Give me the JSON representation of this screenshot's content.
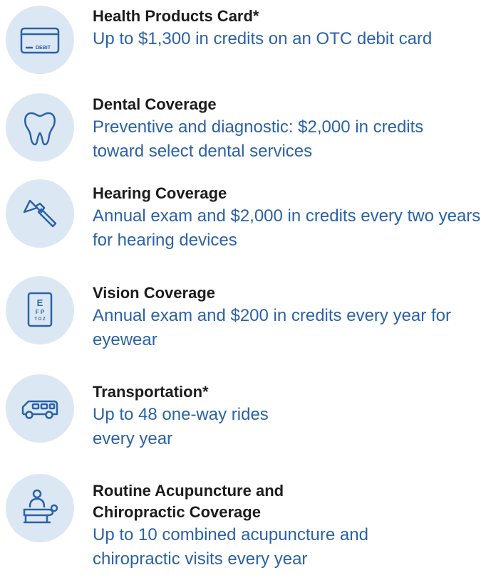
{
  "benefits": [
    {
      "icon": "debit-card-icon",
      "icon_text": "DEBIT",
      "title": "Health Products Card*",
      "description": "Up to $1,300 in credits on an OTC debit card"
    },
    {
      "icon": "tooth-icon",
      "title": "Dental Coverage",
      "description": "Preventive and diagnostic: $2,000 in credits toward select dental services"
    },
    {
      "icon": "otoscope-icon",
      "title": "Hearing Coverage",
      "description": "Annual exam and $2,000 in credits every two years for hearing devices"
    },
    {
      "icon": "eye-chart-icon",
      "icon_text": [
        "E",
        "F P",
        "T O Z"
      ],
      "title": "Vision Coverage",
      "description": "Annual exam and $200 in credits every year for eyewear"
    },
    {
      "icon": "van-icon",
      "title": "Transportation*",
      "description_lines": [
        "Up to 48 one-way rides",
        "every year"
      ]
    },
    {
      "icon": "massage-table-icon",
      "title_lines": [
        "Routine Acupuncture and",
        "Chiropractic Coverage"
      ],
      "description_lines": [
        "Up to 10 combined acupuncture and",
        "chiropractic visits every year"
      ]
    }
  ],
  "colors": {
    "icon_circle": "#dbe8f4",
    "icon_stroke": "#2a62a8",
    "title_text": "#1c1c1c",
    "description_text": "#2a62a8"
  }
}
